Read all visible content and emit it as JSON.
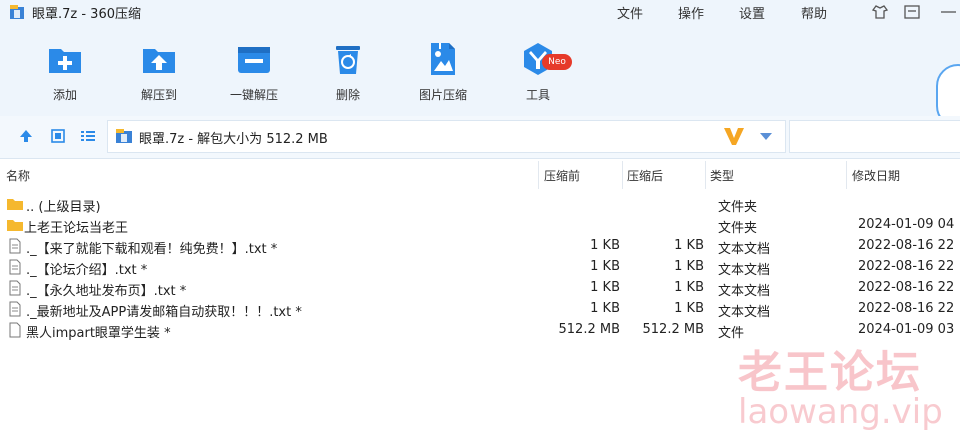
{
  "window": {
    "title": "眼罩.7z - 360压缩"
  },
  "menu": [
    "文件",
    "操作",
    "设置",
    "帮助"
  ],
  "toolbar": [
    {
      "label": "添加",
      "icon": "add-folder-icon"
    },
    {
      "label": "解压到",
      "icon": "extract-to-icon"
    },
    {
      "label": "一键解压",
      "icon": "one-click-extract-icon"
    },
    {
      "label": "删除",
      "icon": "recycle-bin-icon"
    },
    {
      "label": "图片压缩",
      "icon": "image-compress-icon"
    },
    {
      "label": "工具",
      "icon": "tools-icon",
      "badge": "Neo"
    }
  ],
  "nav": {
    "path": "眼罩.7z - 解包大小为 512.2 MB"
  },
  "columns": {
    "name": "名称",
    "compressed": "压缩前",
    "uncompressed": "压缩后",
    "type": "类型",
    "modified": "修改日期"
  },
  "files": [
    {
      "name": ".. (上级目录)",
      "compressed": "",
      "uncompressed": "",
      "type": "文件夹",
      "modified": "",
      "icon": "folder-icon"
    },
    {
      "name": "上老王论坛当老王",
      "compressed": "",
      "uncompressed": "",
      "type": "文件夹",
      "modified": "2024-01-09 04",
      "icon": "folder-icon"
    },
    {
      "name": "._【来了就能下载和观看！纯免费！】.txt *",
      "compressed": "1 KB",
      "uncompressed": "1 KB",
      "type": "文本文档",
      "modified": "2022-08-16 22",
      "icon": "text-file-icon"
    },
    {
      "name": "._【论坛介绍】.txt *",
      "compressed": "1 KB",
      "uncompressed": "1 KB",
      "type": "文本文档",
      "modified": "2022-08-16 22",
      "icon": "text-file-icon"
    },
    {
      "name": "._【永久地址发布页】.txt *",
      "compressed": "1 KB",
      "uncompressed": "1 KB",
      "type": "文本文档",
      "modified": "2022-08-16 22",
      "icon": "text-file-icon"
    },
    {
      "name": "._最新地址及APP请发邮箱自动获取！！！.txt *",
      "compressed": "1 KB",
      "uncompressed": "1 KB",
      "type": "文本文档",
      "modified": "2022-08-16 22",
      "icon": "text-file-icon"
    },
    {
      "name": "黑人impart眼罩学生装 *",
      "compressed": "512.2 MB",
      "uncompressed": "512.2 MB",
      "type": "文件",
      "modified": "2024-01-09 03",
      "icon": "file-icon"
    }
  ],
  "watermark": {
    "cn": "老王论坛",
    "en": "laowang.vip"
  },
  "colors": {
    "accent": "#2b8ae8",
    "folder": "#f5b82e",
    "badge": "#e63a2a"
  }
}
